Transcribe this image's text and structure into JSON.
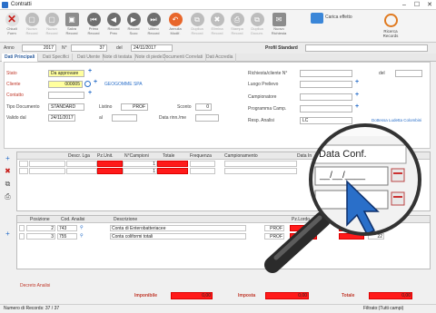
{
  "window": {
    "title": "Contratti"
  },
  "toolbar": {
    "buttons": [
      {
        "label": "Chiudi\nForm",
        "glyph": "✕",
        "kind": "red"
      },
      {
        "label": "Nuovo\nRecord",
        "glyph": "▢",
        "kind": "dis"
      },
      {
        "label": "Nuovo\nRecord",
        "glyph": "▢",
        "kind": "dis"
      },
      {
        "label": "Salva\nRecord",
        "glyph": "▣",
        "kind": "sq"
      },
      {
        "label": "Primo\nRecord",
        "glyph": "⏮",
        "kind": "n"
      },
      {
        "label": "Record\nPrec",
        "glyph": "◀",
        "kind": "n"
      },
      {
        "label": "Record\nSucc",
        "glyph": "▶",
        "kind": "n"
      },
      {
        "label": "Ultimo\nRecord",
        "glyph": "⏭",
        "kind": "n"
      },
      {
        "label": "Annulla\nModif.",
        "glyph": "↶",
        "kind": "hl"
      },
      {
        "label": "Duplica\nRecord",
        "glyph": "⧉",
        "kind": "dis"
      },
      {
        "label": "Elimina\nRecord",
        "glyph": "✖",
        "kind": "dis"
      },
      {
        "label": "Stampa\nRecord",
        "glyph": "⎙",
        "kind": "dis"
      },
      {
        "label": "Duplica\nDocum.",
        "glyph": "⧉",
        "kind": "dis"
      },
      {
        "label": "Nuovo\nRichiesta",
        "glyph": "✉",
        "kind": "sq"
      }
    ],
    "carica_effetto": "Carica effetto",
    "search_label": "Ricerca\nRecords"
  },
  "header": {
    "anno_label": "Anno",
    "anno_value": "2017",
    "num_label": "N°",
    "num_value": "37",
    "del_label": "del",
    "del_value": "24/11/2017",
    "profil_label": "Profil Standard"
  },
  "tabs": [
    "Dati Principali",
    "Dati Specifici",
    "Dati Utente",
    "Note di testata",
    "Note di piede",
    "Documenti Correlati",
    "Dati Accredia"
  ],
  "form": {
    "stato_label": "Stato",
    "stato_value": "Da approvare",
    "cliente_label": "Cliente",
    "cliente_value": "000005",
    "cliente_name": "GEOGOMME SPA",
    "contatto_label": "Contatto",
    "tipo_label": "Tipo Documento",
    "tipo_value": "STANDARD",
    "listino_label": "Listino",
    "listino_value": "PROF",
    "sconto_label": "Sconto",
    "sconto_value": "0",
    "valido_label": "Valido dal",
    "valido_value": "24/11/2017",
    "al_label": "al",
    "data_label": "Data rinn./me",
    "richiesta_label": "Richiesta/cliente N°",
    "richiesta_del": "del",
    "luogo_label": "Luogo Prelievo",
    "campionatore_label": "Campionatore",
    "programma_label": "Programma Camp.",
    "resp_label": "Resp. Analisi",
    "resp_value": "LC",
    "resp_name": "Dottessa Ludetta Colombini"
  },
  "grid1": {
    "headers": [
      "Descr. Lga",
      "Pz.Unit.",
      "N°Campioni",
      "Totale",
      "Frequenza",
      "Campionamento",
      "Data In"
    ],
    "row1": {
      "num": "1",
      "qty": "1"
    },
    "row2": {
      "num": "1",
      "qty": "1"
    }
  },
  "grid2": {
    "headers": [
      "Posizione",
      "Cod. Analisi",
      "Descrizione",
      "Pz.Lordo"
    ],
    "rows": [
      {
        "pos": "2",
        "cod": "743",
        "desc": "Conta di Enterobatteriacee",
        "list": "PROF",
        "pct": "22"
      },
      {
        "pos": "3",
        "cod": "755",
        "desc": "Conta coliformi totali",
        "list": "PROF",
        "pct": "22"
      }
    ]
  },
  "zoom": {
    "label": "Data Conf.",
    "value": "__/__/____"
  },
  "totals": {
    "desc_label": "Decreto Analisi",
    "imponibile_label": "Imponibile",
    "imponibile_value": "0,00",
    "imposta_label": "Imposta",
    "imposta_value": "0,00",
    "totale_label": "Totale",
    "totale_value": "0,00"
  },
  "status": {
    "record": "Numero di Records: 37 / 37",
    "filter": "Filtrato:(Tutti campi)"
  },
  "colors": {
    "accent": "#2a6fc9",
    "required": "#ffff9e",
    "red": "#ff1a1a"
  }
}
